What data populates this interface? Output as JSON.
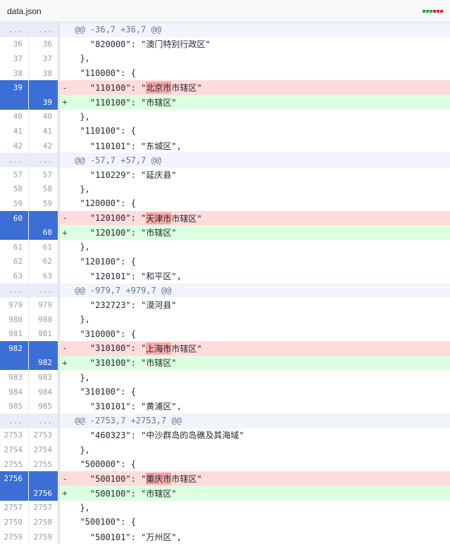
{
  "file": {
    "name": "data.json",
    "diffstat_colors": [
      "#28a745",
      "#28a745",
      "#28a745",
      "#cb2431",
      "#cb2431",
      "#cb2431"
    ]
  },
  "rows": [
    {
      "type": "hunk",
      "old": "...",
      "new": "...",
      "code": "@@ -36,7 +36,7 @@"
    },
    {
      "type": "ctx",
      "old": "36",
      "new": "36",
      "code": "    \"820000\": \"澳门特别行政区\""
    },
    {
      "type": "ctx",
      "old": "37",
      "new": "37",
      "code": "  },"
    },
    {
      "type": "ctx",
      "old": "38",
      "new": "38",
      "code": "  \"110000\": {"
    },
    {
      "type": "del",
      "old": "39",
      "new": "",
      "sign": "-",
      "pre": "    \"110100\": \"",
      "hl": "北京市",
      "post": "市辖区\""
    },
    {
      "type": "add",
      "old": "",
      "new": "39",
      "sign": "+",
      "code": "    \"110100\": \"市辖区\""
    },
    {
      "type": "ctx",
      "old": "40",
      "new": "40",
      "code": "  },"
    },
    {
      "type": "ctx",
      "old": "41",
      "new": "41",
      "code": "  \"110100\": {"
    },
    {
      "type": "ctx",
      "old": "42",
      "new": "42",
      "code": "    \"110101\": \"东城区\","
    },
    {
      "type": "hunk",
      "old": "...",
      "new": "...",
      "code": "@@ -57,7 +57,7 @@"
    },
    {
      "type": "ctx",
      "old": "57",
      "new": "57",
      "code": "    \"110229\": \"延庆县\""
    },
    {
      "type": "ctx",
      "old": "58",
      "new": "58",
      "code": "  },"
    },
    {
      "type": "ctx",
      "old": "59",
      "new": "59",
      "code": "  \"120000\": {"
    },
    {
      "type": "del",
      "old": "60",
      "new": "",
      "sign": "-",
      "pre": "    \"120100\": \"",
      "hl": "天津市",
      "post": "市辖区\""
    },
    {
      "type": "add",
      "old": "",
      "new": "60",
      "sign": "+",
      "code": "    \"120100\": \"市辖区\""
    },
    {
      "type": "ctx",
      "old": "61",
      "new": "61",
      "code": "  },"
    },
    {
      "type": "ctx",
      "old": "62",
      "new": "62",
      "code": "  \"120100\": {"
    },
    {
      "type": "ctx",
      "old": "63",
      "new": "63",
      "code": "    \"120101\": \"和平区\","
    },
    {
      "type": "hunk",
      "old": "...",
      "new": "...",
      "code": "@@ -979,7 +979,7 @@"
    },
    {
      "type": "ctx",
      "old": "979",
      "new": "979",
      "code": "    \"232723\": \"漠河县\""
    },
    {
      "type": "ctx",
      "old": "980",
      "new": "980",
      "code": "  },"
    },
    {
      "type": "ctx",
      "old": "981",
      "new": "981",
      "code": "  \"310000\": {"
    },
    {
      "type": "del",
      "old": "982",
      "new": "",
      "sign": "-",
      "pre": "    \"310100\": \"",
      "hl": "上海市",
      "post": "市辖区\""
    },
    {
      "type": "add",
      "old": "",
      "new": "982",
      "sign": "+",
      "code": "    \"310100\": \"市辖区\""
    },
    {
      "type": "ctx",
      "old": "983",
      "new": "983",
      "code": "  },"
    },
    {
      "type": "ctx",
      "old": "984",
      "new": "984",
      "code": "  \"310100\": {"
    },
    {
      "type": "ctx",
      "old": "985",
      "new": "985",
      "code": "    \"310101\": \"黄浦区\","
    },
    {
      "type": "hunk",
      "old": "...",
      "new": "...",
      "code": "@@ -2753,7 +2753,7 @@"
    },
    {
      "type": "ctx",
      "old": "2753",
      "new": "2753",
      "code": "    \"460323\": \"中沙群岛的岛礁及其海域\""
    },
    {
      "type": "ctx",
      "old": "2754",
      "new": "2754",
      "code": "  },"
    },
    {
      "type": "ctx",
      "old": "2755",
      "new": "2755",
      "code": "  \"500000\": {"
    },
    {
      "type": "del",
      "old": "2756",
      "new": "",
      "sign": "-",
      "pre": "    \"500100\": \"",
      "hl": "重庆市",
      "post": "市辖区\""
    },
    {
      "type": "add",
      "old": "",
      "new": "2756",
      "sign": "+",
      "code": "    \"500100\": \"市辖区\""
    },
    {
      "type": "ctx",
      "old": "2757",
      "new": "2757",
      "code": "  },"
    },
    {
      "type": "ctx",
      "old": "2758",
      "new": "2758",
      "code": "  \"500100\": {"
    },
    {
      "type": "ctx",
      "old": "2759",
      "new": "2759",
      "code": "    \"500101\": \"万州区\","
    }
  ]
}
